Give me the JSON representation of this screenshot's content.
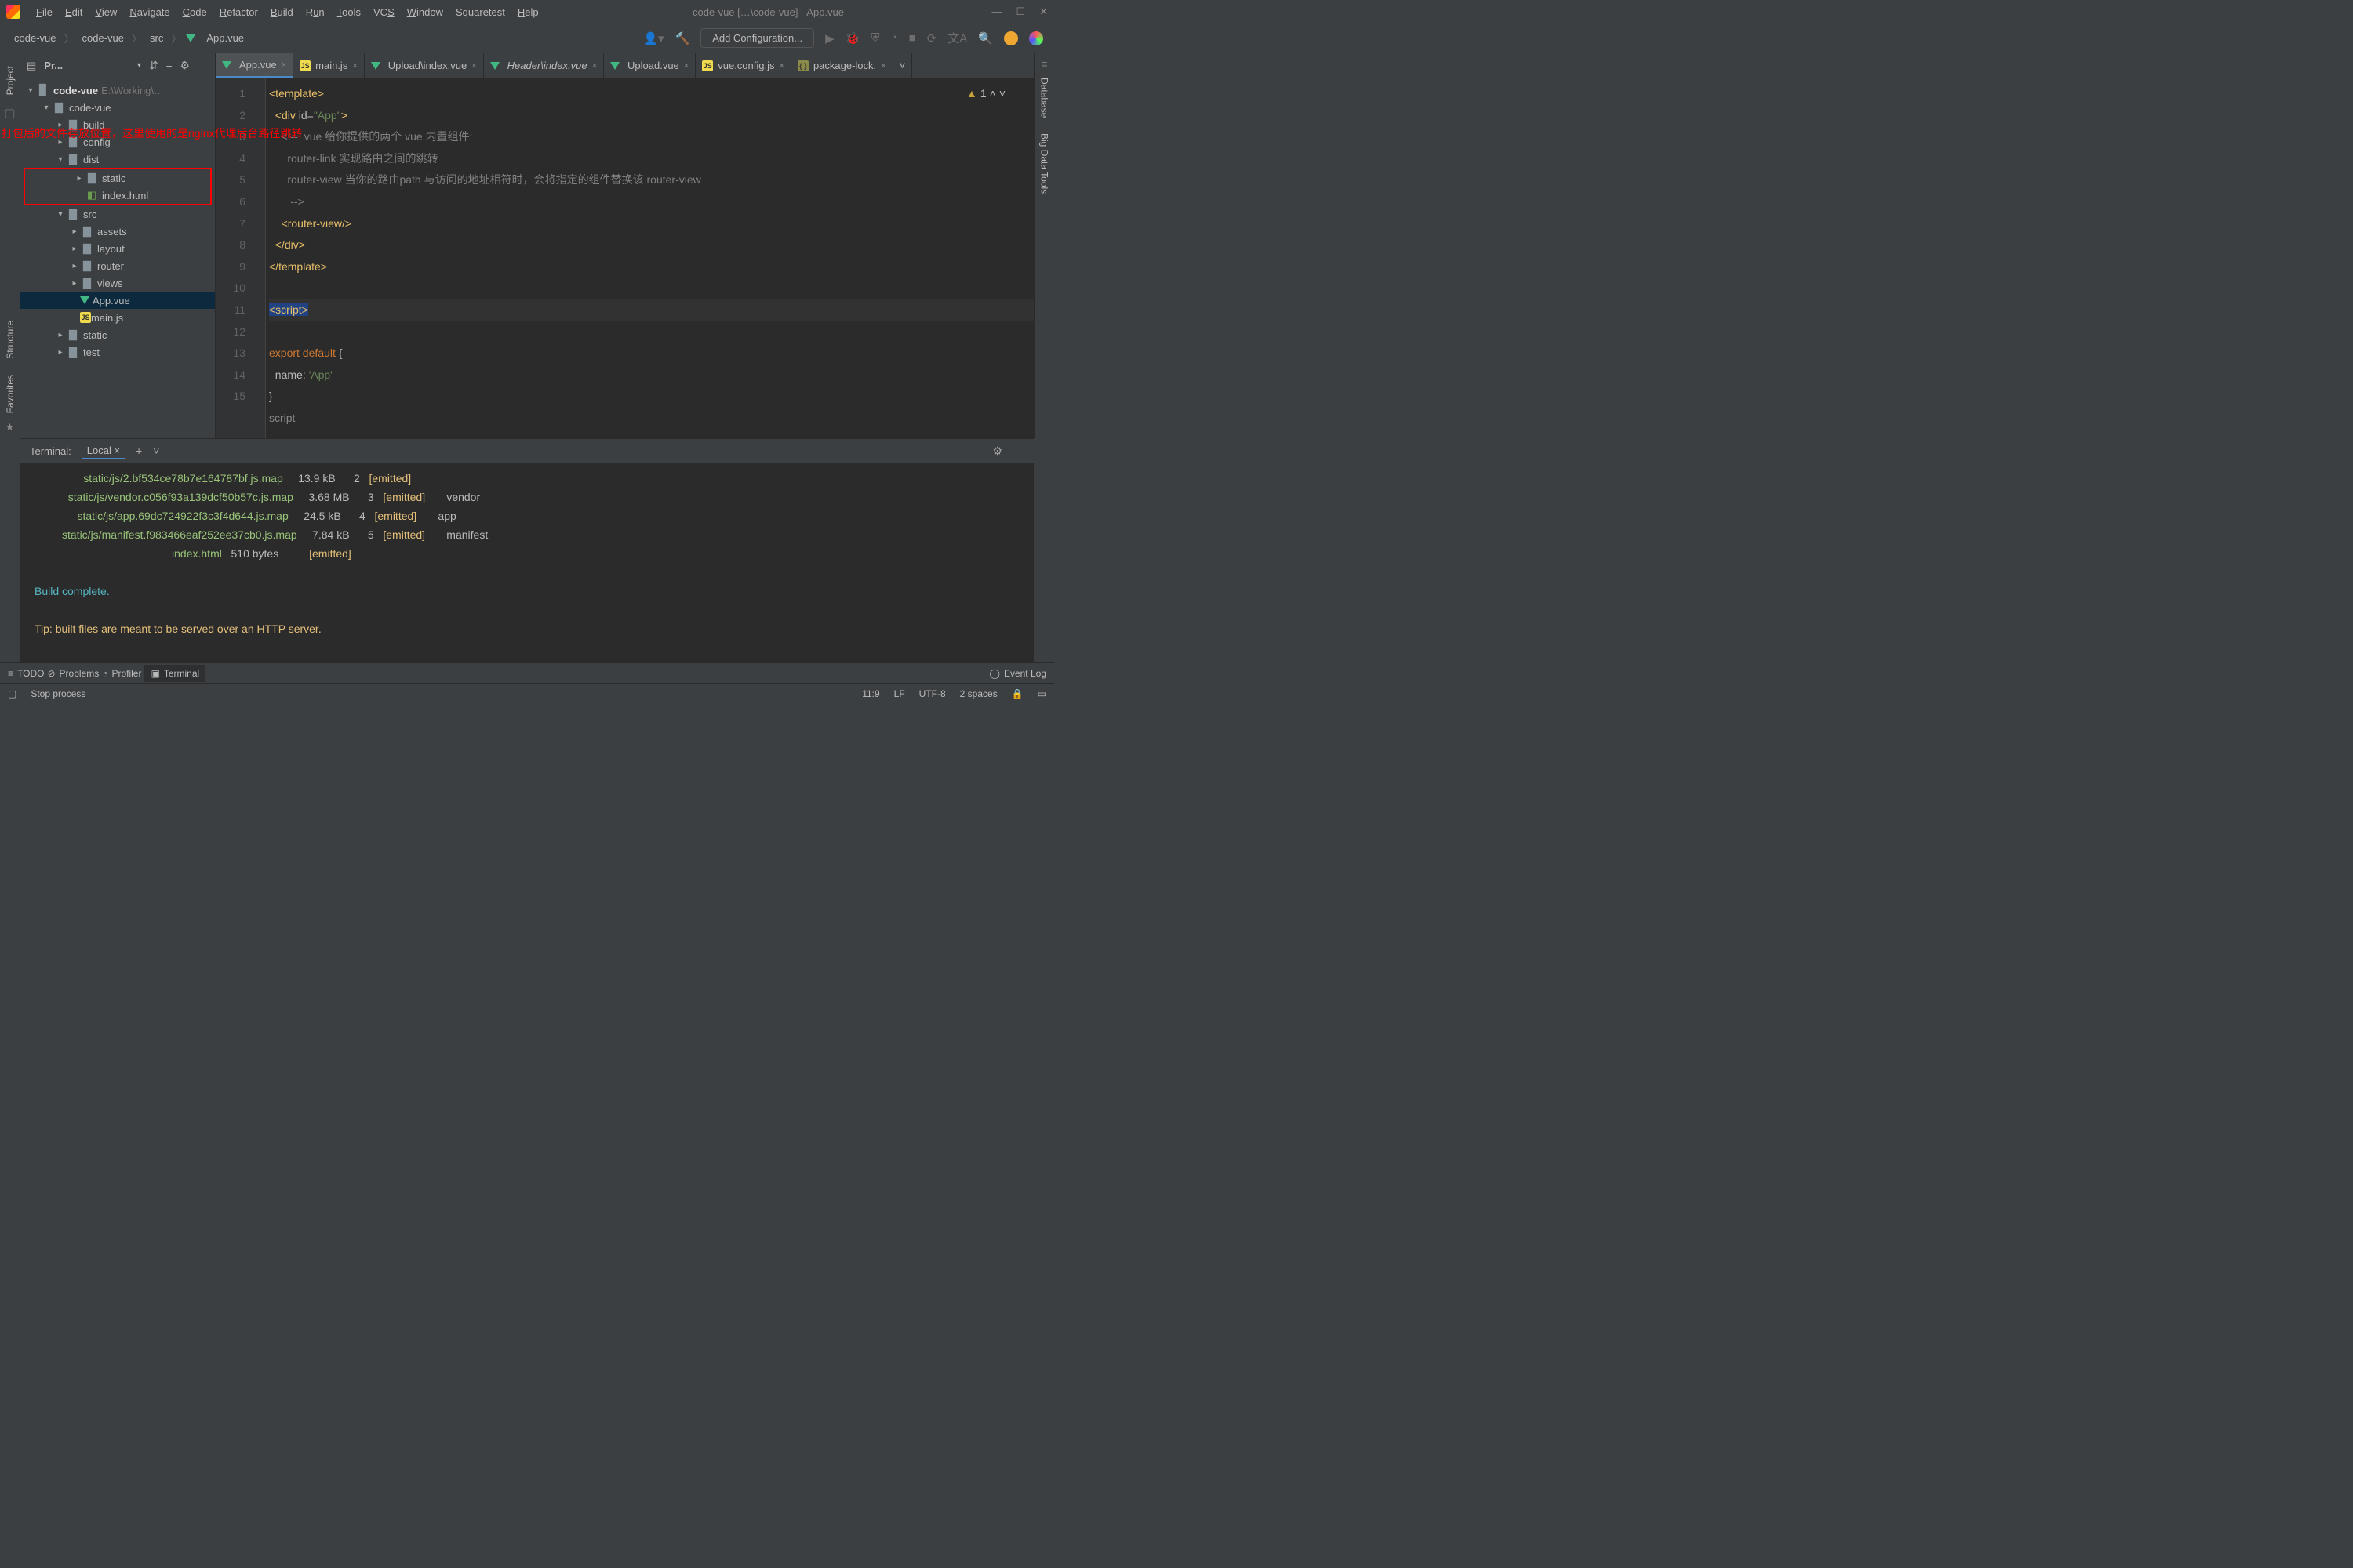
{
  "window": {
    "title": "code-vue […\\code-vue] - App.vue",
    "menus": [
      "File",
      "Edit",
      "View",
      "Navigate",
      "Code",
      "Refactor",
      "Build",
      "Run",
      "Tools",
      "VCS",
      "Window",
      "Squaretest",
      "Help"
    ]
  },
  "breadcrumb": {
    "items": [
      "code-vue",
      "code-vue",
      "src",
      "App.vue"
    ]
  },
  "runcfg": {
    "label": "Add Configuration..."
  },
  "project_header": {
    "label": "Pr..."
  },
  "tree": {
    "root": {
      "name": "code-vue",
      "hint": "E:\\Working\\…"
    },
    "nodes": [
      {
        "indent": 1,
        "exp": "▾",
        "icon": "folder",
        "name": "code-vue"
      },
      {
        "indent": 2,
        "exp": "▸",
        "icon": "folder",
        "name": "build"
      },
      {
        "indent": 2,
        "exp": "▸",
        "icon": "folder",
        "name": "config"
      },
      {
        "indent": 2,
        "exp": "▾",
        "icon": "folder",
        "name": "dist"
      },
      {
        "indent": 3,
        "exp": "▸",
        "icon": "folder",
        "name": "static",
        "hl": true
      },
      {
        "indent": 3,
        "exp": "",
        "icon": "html",
        "name": "index.html",
        "hl": true
      },
      {
        "indent": 2,
        "exp": "▾",
        "icon": "folder",
        "name": "src"
      },
      {
        "indent": 3,
        "exp": "▸",
        "icon": "folder",
        "name": "assets"
      },
      {
        "indent": 3,
        "exp": "▸",
        "icon": "folder",
        "name": "layout"
      },
      {
        "indent": 3,
        "exp": "▸",
        "icon": "folder",
        "name": "router"
      },
      {
        "indent": 3,
        "exp": "▸",
        "icon": "folder",
        "name": "views"
      },
      {
        "indent": 3,
        "exp": "",
        "icon": "vue",
        "name": "App.vue",
        "sel": true
      },
      {
        "indent": 3,
        "exp": "",
        "icon": "js",
        "name": "main.js"
      },
      {
        "indent": 2,
        "exp": "▸",
        "icon": "folder",
        "name": "static"
      },
      {
        "indent": 2,
        "exp": "▸",
        "icon": "folder",
        "name": "test"
      }
    ]
  },
  "annotation": "打包后的文件存放位置，这里使用的是nginx代理后台路径跳转",
  "tabs": [
    {
      "icon": "vue",
      "label": "App.vue",
      "active": true
    },
    {
      "icon": "js",
      "label": "main.js"
    },
    {
      "icon": "vue",
      "label": "Upload\\index.vue"
    },
    {
      "icon": "vue",
      "label": "Header\\index.vue",
      "italic": true
    },
    {
      "icon": "vue",
      "label": "Upload.vue"
    },
    {
      "icon": "js",
      "label": "vue.config.js"
    },
    {
      "icon": "json",
      "label": "package-lock."
    }
  ],
  "warn_count": "1",
  "code_lines": [
    1,
    2,
    3,
    4,
    5,
    6,
    7,
    8,
    9,
    10,
    11,
    12,
    13,
    14,
    15
  ],
  "code_crumb": "script",
  "terminal": {
    "title": "Terminal:",
    "tab": "Local",
    "lines": [
      {
        "p1": "",
        "file": "static/js/2.bf534ce78b7e164787bf.js.map",
        "size": "13.9 kB",
        "idx": "2",
        "emit": "[emitted]",
        "post": ""
      },
      {
        "p1": "",
        "file": "static/js/vendor.c056f93a139dcf50b57c.js.map",
        "size": "3.68 MB",
        "idx": "3",
        "emit": "[emitted]",
        "post": "vendor"
      },
      {
        "p1": "",
        "file": "static/js/app.69dc724922f3c3f4d644.js.map",
        "size": "24.5 kB",
        "idx": "4",
        "emit": "[emitted]",
        "post": "app"
      },
      {
        "p1": "",
        "file": "static/js/manifest.f983466eaf252ee37cb0.js.map",
        "size": "7.84 kB",
        "idx": "5",
        "emit": "[emitted]",
        "post": "manifest"
      },
      {
        "p1": "",
        "file": "index.html",
        "size": "510 bytes",
        "idx": "",
        "emit": "[emitted]",
        "post": ""
      }
    ],
    "done": "Build complete.",
    "tip": "Tip: built files are meant to be served over an HTTP server."
  },
  "bottom_tools": [
    {
      "icon": "≡",
      "label": "TODO"
    },
    {
      "icon": "⊘",
      "label": "Problems"
    },
    {
      "icon": "◔",
      "label": "Profiler"
    },
    {
      "icon": "▣",
      "label": "Terminal",
      "active": true
    }
  ],
  "event_log": "Event Log",
  "status": {
    "left": "Stop process",
    "pos": "11:9",
    "lf": "LF",
    "enc": "UTF-8",
    "indent": "2 spaces"
  },
  "right_tools": [
    "Database",
    "Big Data Tools"
  ],
  "left_tools": [
    "Project"
  ],
  "left_bottom": [
    "Structure",
    "Favorites"
  ]
}
